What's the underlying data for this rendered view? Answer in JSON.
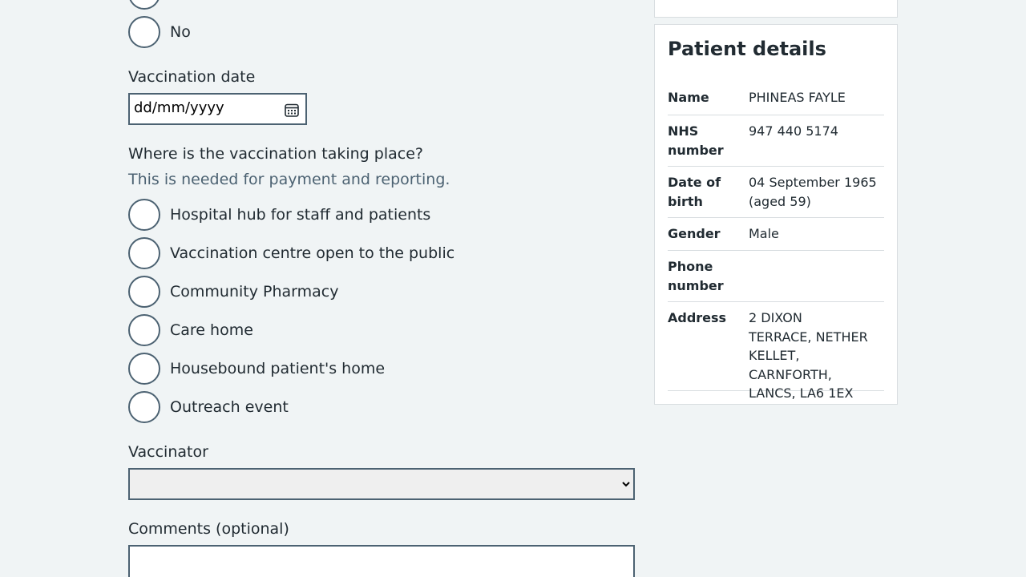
{
  "form": {
    "previous_question": {
      "options": [
        "No"
      ]
    },
    "vaccination_date": {
      "label": "Vaccination date",
      "placeholder": "dd/mm/yyyy"
    },
    "location": {
      "question": "Where is the vaccination taking place?",
      "hint": "This is needed for payment and reporting.",
      "options": [
        "Hospital hub for staff and patients",
        "Vaccination centre open to the public",
        "Community Pharmacy",
        "Care home",
        "Housebound patient's home",
        "Outreach event"
      ]
    },
    "vaccinator": {
      "label": "Vaccinator",
      "selected": ""
    },
    "comments": {
      "label": "Comments (optional)",
      "value": ""
    }
  },
  "patient_details": {
    "title": "Patient details",
    "rows": [
      {
        "key": "Name",
        "value": "PHINEAS FAYLE"
      },
      {
        "key": "NHS number",
        "value": "947 440 5174"
      },
      {
        "key": "Date of birth",
        "value": "04 September 1965 (aged 59)"
      },
      {
        "key": "Gender",
        "value": "Male"
      },
      {
        "key": "Phone number",
        "value": ""
      },
      {
        "key": "Address",
        "value": "2 DIXON TERRACE, NETHER KELLET, CARNFORTH, LANCS, LA6 1EX"
      }
    ]
  },
  "icons": {
    "calendar": "calendar-icon",
    "select_chevron": "chevron-down-icon"
  },
  "colors": {
    "background": "#f0f4f5",
    "text": "#212b32",
    "hint": "#4c6272",
    "input_border": "#4c6272",
    "card_border": "#d8dde0"
  }
}
